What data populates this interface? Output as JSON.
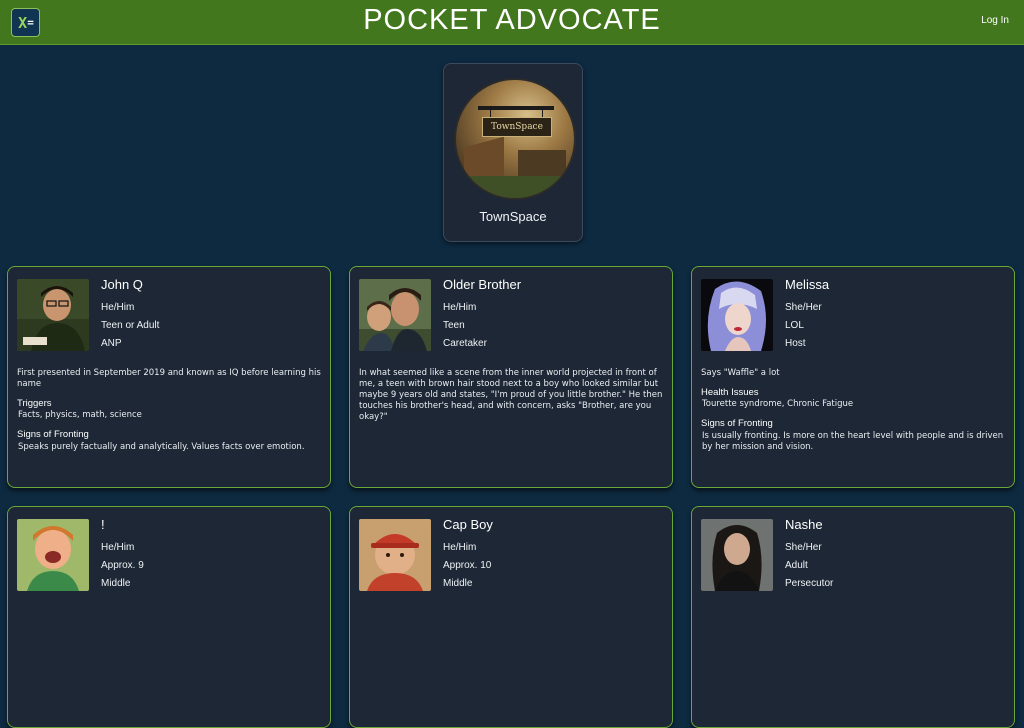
{
  "header": {
    "logo_text": "X",
    "logo_eq": "=",
    "title": "POCKET ADVOCATE",
    "login": "Log In"
  },
  "system": {
    "sign_text": "TownSpace",
    "name": "TownSpace"
  },
  "cards": [
    {
      "name": "John Q",
      "pronouns": "He/Him",
      "age": "Teen or Adult",
      "role": "ANP",
      "description": "First presented in September 2019 and known as IQ before learning his name",
      "sections": [
        {
          "title": "Triggers",
          "text": "Facts, physics, math, science"
        },
        {
          "title": "Signs of Fronting",
          "text": "Speaks purely factually and analytically. Values facts over emotion."
        }
      ]
    },
    {
      "name": "Older Brother",
      "pronouns": "He/Him",
      "age": "Teen",
      "role": "Caretaker",
      "description": "In what seemed like a scene from the inner world projected in front of me, a teen with brown hair stood next to a boy who looked similar but maybe 9 years old and states, \"I'm proud of you little brother.\" He then touches his brother's head, and with concern, asks \"Brother, are you okay?\"",
      "sections": []
    },
    {
      "name": "Melissa",
      "pronouns": "She/Her",
      "age": "LOL",
      "role": "Host",
      "description": "Says \"Waffle\" a lot",
      "sections": [
        {
          "title": "Health Issues",
          "text": "Tourette syndrome, Chronic Fatigue"
        },
        {
          "title": "Signs of Fronting",
          "text": "Is usually fronting. Is more on the heart level with people and is driven by her mission and vision."
        }
      ]
    },
    {
      "name": "!",
      "pronouns": "He/Him",
      "age": "Approx. 9",
      "role": "Middle",
      "description": "",
      "sections": []
    },
    {
      "name": "Cap Boy",
      "pronouns": "He/Him",
      "age": "Approx. 10",
      "role": "Middle",
      "description": "",
      "sections": []
    },
    {
      "name": "Nashe",
      "pronouns": "She/Her",
      "age": "Adult",
      "role": "Persecutor",
      "description": "",
      "sections": []
    }
  ]
}
